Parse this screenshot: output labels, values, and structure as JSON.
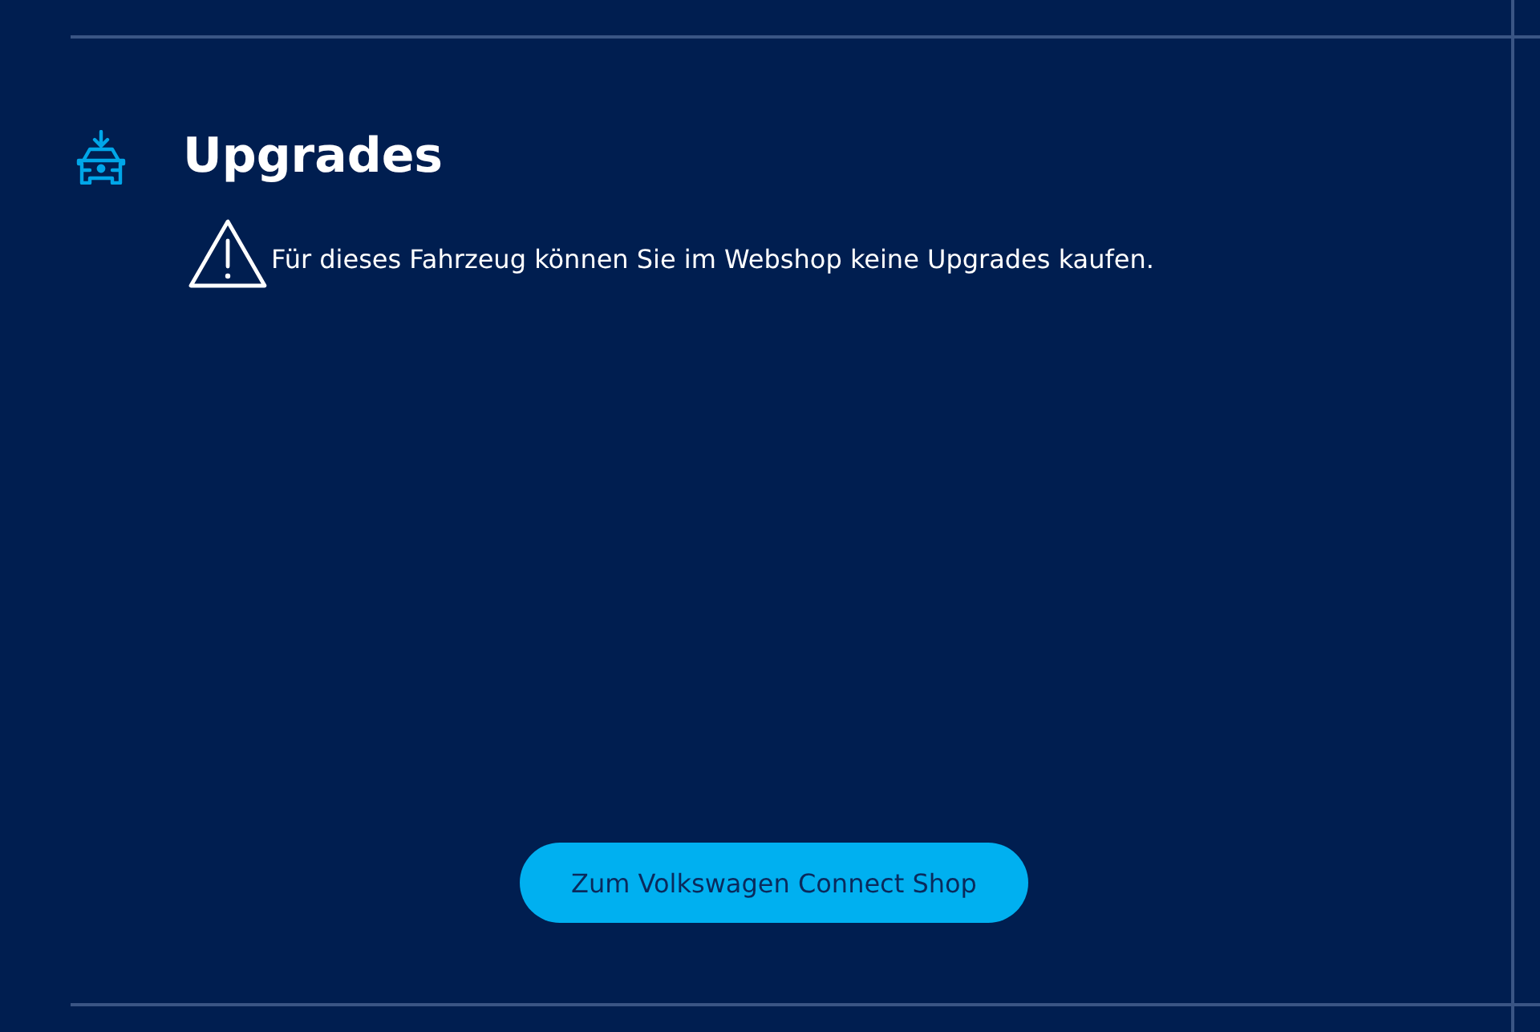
{
  "section": {
    "title": "Upgrades"
  },
  "notice": {
    "text": "Für dieses Fahrzeug können Sie im Webshop keine Upgrades kaufen."
  },
  "button": {
    "label": "Zum Volkswagen Connect Shop"
  }
}
